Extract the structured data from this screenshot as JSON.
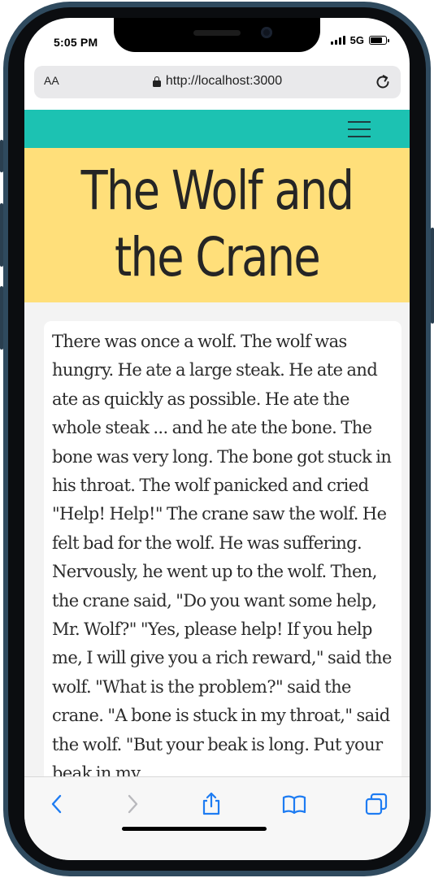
{
  "status_bar": {
    "time": "5:05 PM",
    "network": "5G"
  },
  "browser": {
    "text_size_label": "AA",
    "url": "http://localhost:3000"
  },
  "site": {
    "menu_icon": "hamburger-menu-icon",
    "title": "The Wolf and the Crane",
    "story_text": "There was once a wolf. The wolf was hungry. He ate a large steak. He ate and ate as quickly as possible. He ate the whole steak ... and he ate the bone. The bone was very long. The bone got stuck in his throat. The wolf panicked and cried \"Help! Help!\" The crane saw the wolf. He felt bad for the wolf. He was suffering. Nervously, he went up to the wolf. Then, the crane said, \"Do you want some help, Mr. Wolf?\" \"Yes, please help! If you help me, I will give you a rich reward,\" said the wolf. \"What is the problem?\" said the crane. \"A bone is stuck in my throat,\" said the wolf. \"But your beak is long. Put your beak in my"
  },
  "toolbar": {
    "icons": [
      "back-icon",
      "forward-icon",
      "share-icon",
      "bookmarks-icon",
      "tabs-icon"
    ]
  },
  "colors": {
    "navbar": "#1cc2b2",
    "hero": "#ffdf7a",
    "page_bg": "#f3f3f3",
    "accent": "#1e7cf2"
  }
}
